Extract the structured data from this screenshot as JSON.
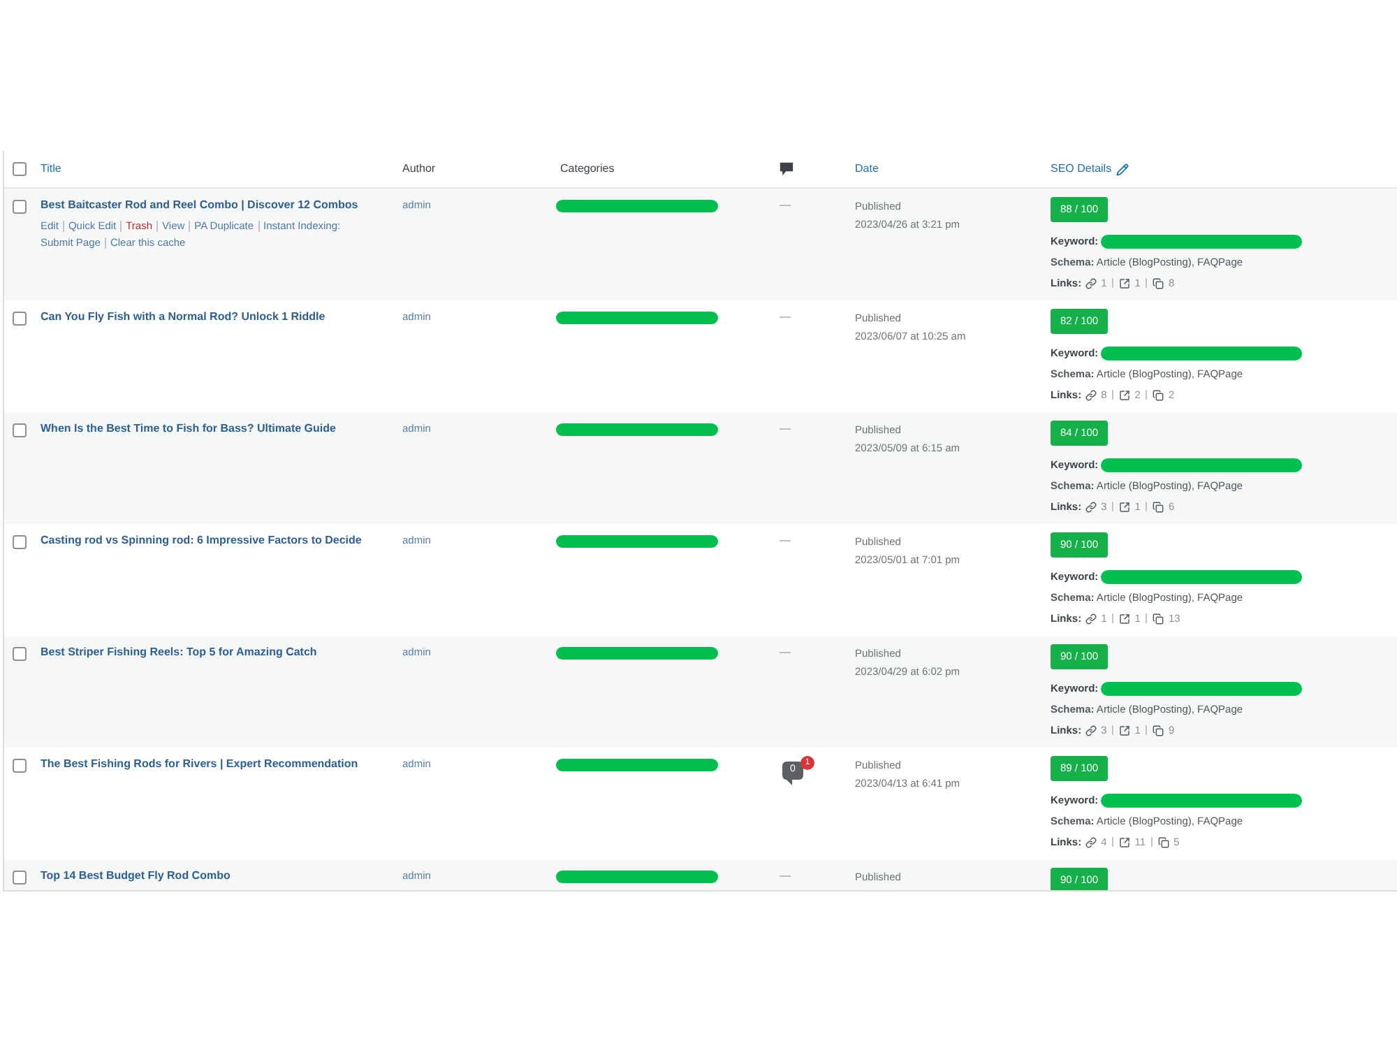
{
  "table": {
    "select_all": {
      "checked": false
    },
    "columns": [
      {
        "kind": "title",
        "label": "Title",
        "sortable": true
      },
      {
        "kind": "author",
        "label": "Author",
        "sortable": false
      },
      {
        "kind": "categories",
        "label": "Categories",
        "sortable": false
      },
      {
        "kind": "comments"
      },
      {
        "kind": "date",
        "label": "Date",
        "sortable": true
      },
      {
        "kind": "seo",
        "label": "SEO Details",
        "sortable": true
      }
    ],
    "rows": [
      {
        "checked": false,
        "title": "Best Baitcaster Rod and Reel Combo | Discover 12 Combos",
        "actions": [
          {
            "kind": "link",
            "label": "Edit"
          },
          {
            "kind": "link",
            "label": "Quick Edit"
          },
          {
            "kind": "delete",
            "label": "Trash"
          },
          {
            "kind": "link",
            "label": "View"
          },
          {
            "kind": "link",
            "label": "PA Duplicate"
          },
          {
            "kind": "link",
            "label": "Instant Indexing:",
            "detail": "Submit Page"
          },
          {
            "kind": "link",
            "label": "Clear this cache"
          }
        ],
        "author": "admin",
        "categories": {
          "redacted": true
        },
        "comments": {
          "kind": "none",
          "text": "—"
        },
        "status": "Published",
        "date": "2023/04/26 at 3:21 pm",
        "seo": {
          "score": "88 / 100",
          "keyword": {
            "label": "Keyword:",
            "redacted": true
          },
          "schema": "**Schema:** Article (BlogPosting), FAQPage",
          "links": {
            "label": "Links:",
            "items": [
              {
                "kind": "internal",
                "count": "1"
              },
              {
                "kind": "external",
                "count": "1"
              },
              {
                "kind": "incoming",
                "count": "8"
              }
            ]
          }
        }
      },
      {
        "checked": false,
        "title": "Can You Fly Fish with a Normal Rod? Unlock 1 Riddle",
        "author": "admin",
        "categories": {
          "redacted": true
        },
        "comments": {
          "kind": "none",
          "text": "—"
        },
        "status": "Published",
        "date": "2023/06/07 at 10:25 am",
        "seo": {
          "score": "82 / 100",
          "keyword": {
            "label": "Keyword:",
            "redacted": true
          },
          "schema": "**Schema:** Article (BlogPosting), FAQPage",
          "links": {
            "label": "Links:",
            "items": [
              {
                "kind": "internal",
                "count": "8"
              },
              {
                "kind": "external",
                "count": "2"
              },
              {
                "kind": "incoming",
                "count": "2"
              }
            ]
          }
        }
      },
      {
        "checked": false,
        "title": "When Is the Best Time to Fish for Bass? Ultimate Guide",
        "author": "admin",
        "categories": {
          "redacted": true
        },
        "comments": {
          "kind": "none",
          "text": "—"
        },
        "status": "Published",
        "date": "2023/05/09 at 6:15 am",
        "seo": {
          "score": "84 / 100",
          "keyword": {
            "label": "Keyword:",
            "redacted": true
          },
          "schema": "**Schema:** Article (BlogPosting), FAQPage",
          "links": {
            "label": "Links:",
            "items": [
              {
                "kind": "internal",
                "count": "3"
              },
              {
                "kind": "external",
                "count": "1"
              },
              {
                "kind": "incoming",
                "count": "6"
              }
            ]
          }
        }
      },
      {
        "checked": false,
        "title": "Casting rod vs Spinning rod: 6 Impressive Factors to Decide",
        "author": "admin",
        "categories": {
          "redacted": true
        },
        "comments": {
          "kind": "none",
          "text": "—"
        },
        "status": "Published",
        "date": "2023/05/01 at 7:01 pm",
        "seo": {
          "score": "90 / 100",
          "keyword": {
            "label": "Keyword:",
            "redacted": true
          },
          "schema": "**Schema:** Article (BlogPosting), FAQPage",
          "links": {
            "label": "Links:",
            "items": [
              {
                "kind": "internal",
                "count": "1"
              },
              {
                "kind": "external",
                "count": "1"
              },
              {
                "kind": "incoming",
                "count": "13"
              }
            ]
          }
        }
      },
      {
        "checked": false,
        "title": "Best Striper Fishing Reels: Top 5 for Amazing Catch",
        "author": "admin",
        "categories": {
          "redacted": true
        },
        "comments": {
          "kind": "none",
          "text": "—"
        },
        "status": "Published",
        "date": "2023/04/29 at 6:02 pm",
        "seo": {
          "score": "90 / 100",
          "keyword": {
            "label": "Keyword:",
            "redacted": true
          },
          "schema": "**Schema:** Article (BlogPosting), FAQPage",
          "links": {
            "label": "Links:",
            "items": [
              {
                "kind": "internal",
                "count": "3"
              },
              {
                "kind": "external",
                "count": "1"
              },
              {
                "kind": "incoming",
                "count": "9"
              }
            ]
          }
        }
      },
      {
        "checked": false,
        "title": "The Best Fishing Rods for Rivers | Expert Recommendation",
        "author": "admin",
        "categories": {
          "redacted": true
        },
        "comments": {
          "kind": "bubble",
          "approved": "0",
          "pending": "1"
        },
        "status": "Published",
        "date": "2023/04/13 at 6:41 pm",
        "seo": {
          "score": "89 / 100",
          "keyword": {
            "label": "Keyword:",
            "redacted": true
          },
          "schema": "**Schema:** Article (BlogPosting), FAQPage",
          "links": {
            "label": "Links:",
            "items": [
              {
                "kind": "internal",
                "count": "4"
              },
              {
                "kind": "external",
                "count": "11"
              },
              {
                "kind": "incoming",
                "count": "5"
              }
            ]
          }
        }
      },
      {
        "checked": false,
        "title": "Top 14 Best Budget Fly Rod Combo",
        "author": "admin",
        "categories": {
          "redacted": true
        },
        "comments": {
          "kind": "none",
          "text": "—"
        },
        "status": "Published",
        "seo": {
          "score": "90 / 100"
        }
      }
    ]
  }
}
